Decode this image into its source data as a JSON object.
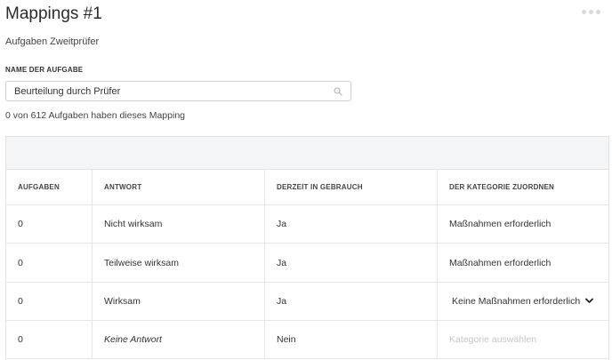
{
  "page": {
    "title": "Mappings #1",
    "subtitle": "Aufgaben Zweitprüfer"
  },
  "task_filter": {
    "label": "NAME DER AUFGABE",
    "value": "Beurteilung durch Prüfer",
    "count_text": "0 von 612 Aufgaben haben dieses Mapping"
  },
  "table": {
    "headers": {
      "aufgaben": "AUFGABEN",
      "antwort": "ANTWORT",
      "gebrauch": "DERZEIT IN GEBRAUCH",
      "kategorie": "DER KATEGORIE ZUORDNEN"
    },
    "rows": [
      {
        "aufgaben": "0",
        "antwort": "Nicht wirksam",
        "gebrauch": "Ja",
        "kategorie": "Maßnahmen erforderlich"
      },
      {
        "aufgaben": "0",
        "antwort": "Teilweise wirksam",
        "gebrauch": "Ja",
        "kategorie": "Maßnahmen erforderlich"
      },
      {
        "aufgaben": "0",
        "antwort": "Wirksam",
        "gebrauch": "Ja",
        "kategorie": "Keine Maßnahmen erforderlich"
      },
      {
        "aufgaben": "0",
        "antwort": "Keine Antwort",
        "gebrauch": "Nein",
        "kategorie_placeholder": "Kategorie auswählen"
      }
    ]
  },
  "icons": {
    "more": "more-horizontal-icon",
    "search": "search-icon",
    "dropdown": "chevron-down-icon"
  },
  "colors": {
    "toolbar_bg": "#f4f5f6",
    "border": "#e3e3e3",
    "placeholder": "#c7c7c7"
  }
}
